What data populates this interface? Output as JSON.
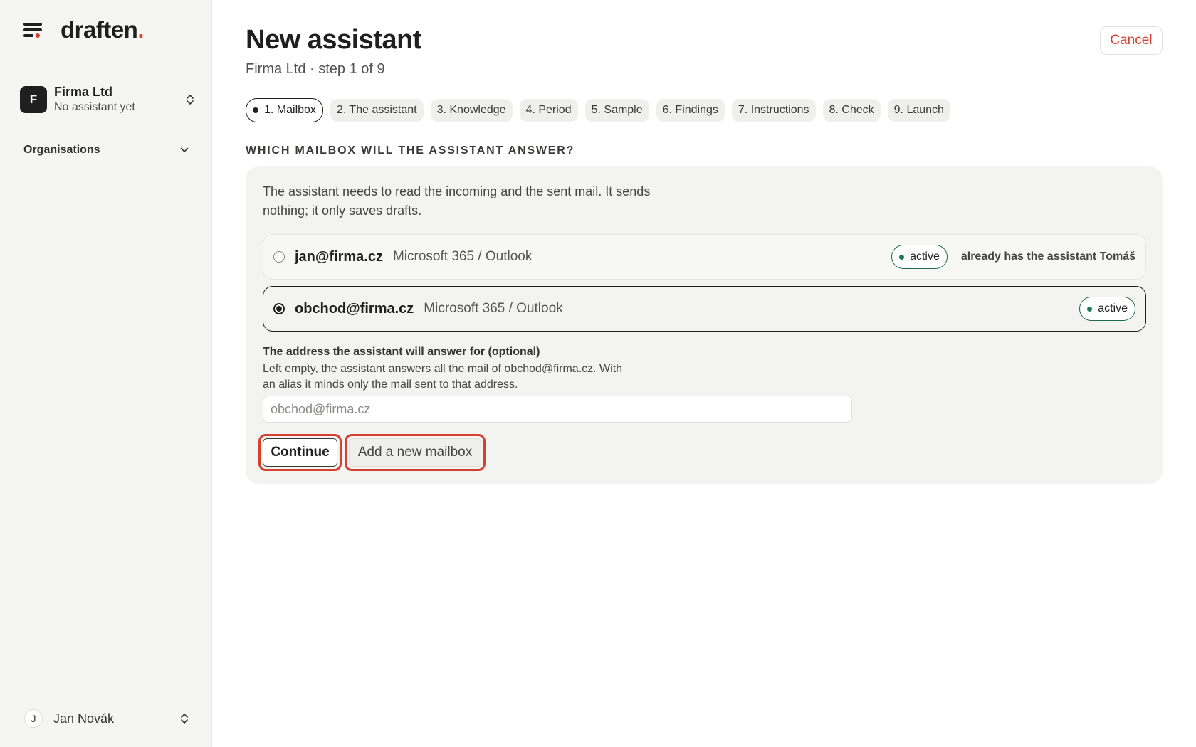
{
  "brand": {
    "logo_text": "draften",
    "logo_dot": ".",
    "accent": "#d6402e"
  },
  "sidebar": {
    "org": {
      "initial": "F",
      "name": "Firma Ltd",
      "subtitle": "No assistant yet"
    },
    "organisations_label": "Organisations",
    "user": {
      "initial": "J",
      "name": "Jan Novák"
    }
  },
  "header": {
    "title": "New assistant",
    "subtitle": "Firma Ltd · step 1 of 9",
    "cancel_label": "Cancel"
  },
  "steps": [
    {
      "label": "1. Mailbox",
      "active": true
    },
    {
      "label": "2. The assistant"
    },
    {
      "label": "3. Knowledge"
    },
    {
      "label": "4. Period"
    },
    {
      "label": "5. Sample"
    },
    {
      "label": "6. Findings"
    },
    {
      "label": "7. Instructions"
    },
    {
      "label": "8. Check"
    },
    {
      "label": "9. Launch"
    }
  ],
  "section": {
    "title": "WHICH MAILBOX WILL THE ASSISTANT ANSWER?",
    "intro": "The assistant needs to read the incoming and the sent mail. It sends nothing; it only saves drafts."
  },
  "mailboxes": [
    {
      "email": "jan@firma.cz",
      "provider": "Microsoft 365 / Outlook",
      "status": "active",
      "note": "already has the assistant Tomáš",
      "selected": false
    },
    {
      "email": "obchod@firma.cz",
      "provider": "Microsoft 365 / Outlook",
      "status": "active",
      "selected": true
    }
  ],
  "alias": {
    "label": "The address the assistant will answer for (optional)",
    "help": "Left empty, the assistant answers all the mail of obchod@firma.cz. With an alias it minds only the mail sent to that address.",
    "placeholder": "obchod@firma.cz",
    "value": ""
  },
  "actions": {
    "continue_label": "Continue",
    "add_mailbox_label": "Add a new mailbox"
  }
}
